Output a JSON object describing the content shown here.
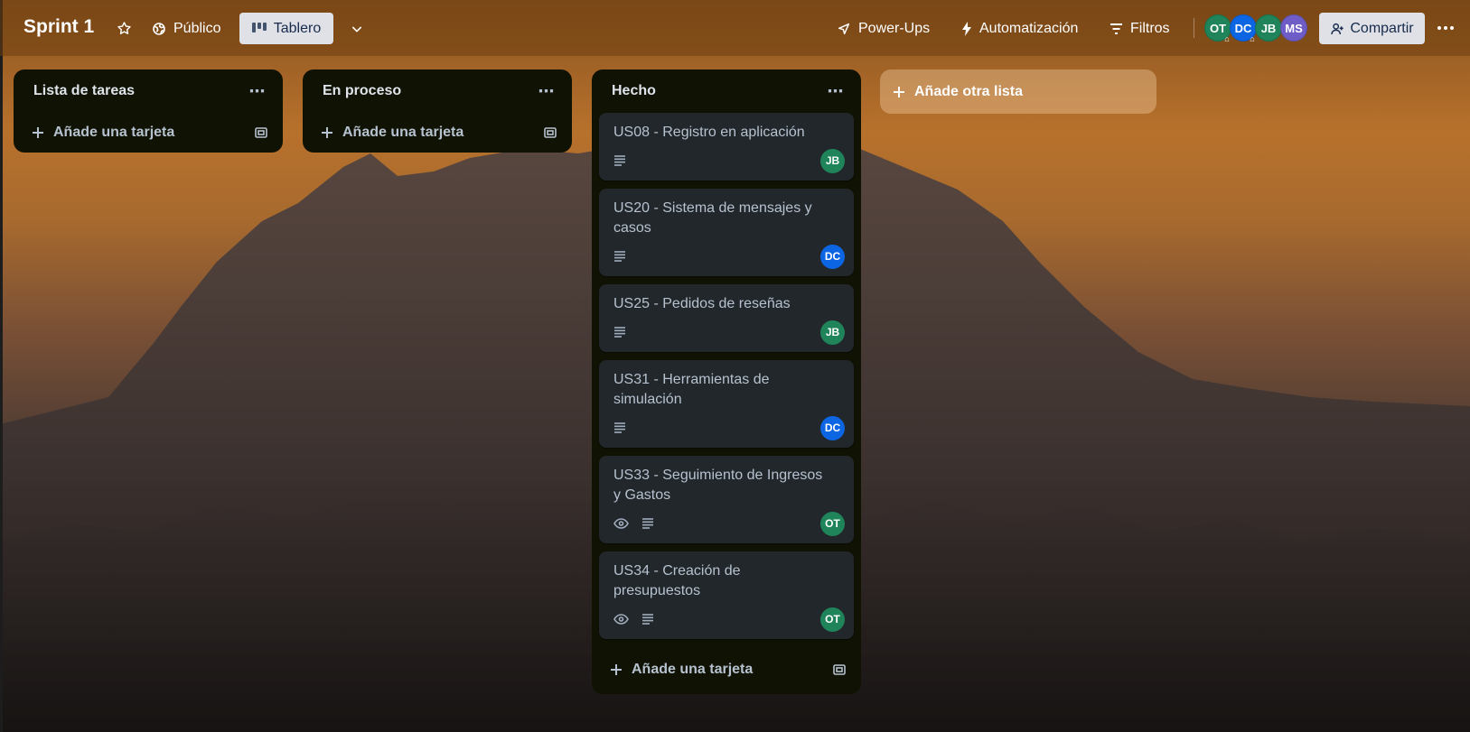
{
  "board": {
    "title": "Sprint 1",
    "visibility_label": "Público",
    "view_label": "Tablero"
  },
  "header": {
    "powerups_label": "Power-Ups",
    "automation_label": "Automatización",
    "filters_label": "Filtros",
    "share_label": "Compartir",
    "members": [
      {
        "initials": "OT",
        "color": "#1f845a"
      },
      {
        "initials": "DC",
        "color": "#0c66e4"
      },
      {
        "initials": "JB",
        "color": "#1f845a"
      },
      {
        "initials": "MS",
        "color": "#6e5dc6"
      }
    ]
  },
  "lists": [
    {
      "title": "Lista de tareas",
      "add_card_label": "Añade una tarjeta"
    },
    {
      "title": "En proceso",
      "add_card_label": "Añade una tarjeta"
    },
    {
      "title": "Hecho",
      "add_card_label": "Añade una tarjeta",
      "cards": [
        {
          "title": "US08 - Registro en aplicación",
          "member": "JB",
          "watch": false
        },
        {
          "title": "US20 - Sistema de mensajes y casos",
          "member": "DC",
          "watch": false
        },
        {
          "title": "US25 - Pedidos de reseñas",
          "member": "JB",
          "watch": false
        },
        {
          "title": "US31 - Herramientas de simulación",
          "member": "DC",
          "watch": false
        },
        {
          "title": "US33 - Seguimiento de Ingresos y Gastos",
          "member": "OT",
          "watch": true
        },
        {
          "title": "US34 - Creación de presupuestos",
          "member": "OT",
          "watch": true
        }
      ]
    }
  ],
  "add_list_label": "Añade otra lista",
  "colors": {
    "list_bg": "#101204",
    "card_bg": "#22272b",
    "member_green": "#1f845a",
    "member_blue": "#0c66e4",
    "member_purple": "#6e5dc6"
  }
}
